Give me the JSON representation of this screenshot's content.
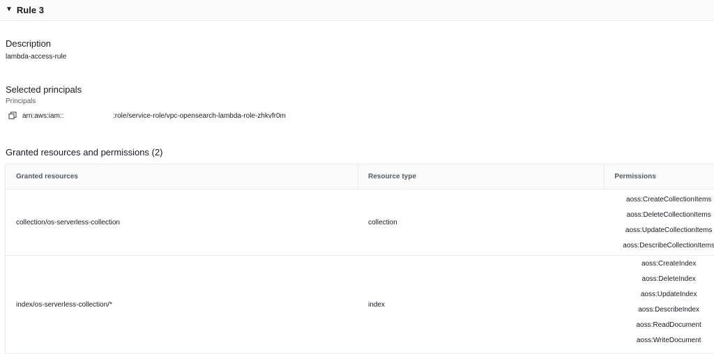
{
  "rule": {
    "title": "Rule 3"
  },
  "description": {
    "title": "Description",
    "value": "lambda-access-rule"
  },
  "principals": {
    "title": "Selected principals",
    "label": "Principals",
    "arn_prefix": "arn:aws:iam::",
    "arn_suffix": ":role/service-role/vpc-opensearch-lambda-role-zhkvfr0m"
  },
  "granted": {
    "title": "Granted resources and permissions (2)",
    "headers": [
      "Granted resources",
      "Resource type",
      "Permissions"
    ],
    "rows": [
      {
        "resource": "collection/os-serverless-collection",
        "type": "collection",
        "permissions": [
          "aoss:CreateCollectionItems",
          "aoss:DeleteCollectionItems",
          "aoss:UpdateCollectionItems",
          "aoss:DescribeCollectionItems"
        ]
      },
      {
        "resource": "index/os-serverless-collection/*",
        "type": "index",
        "permissions": [
          "aoss:CreateIndex",
          "aoss:DeleteIndex",
          "aoss:UpdateIndex",
          "aoss:DescribeIndex",
          "aoss:ReadDocument",
          "aoss:WriteDocument"
        ]
      }
    ]
  }
}
